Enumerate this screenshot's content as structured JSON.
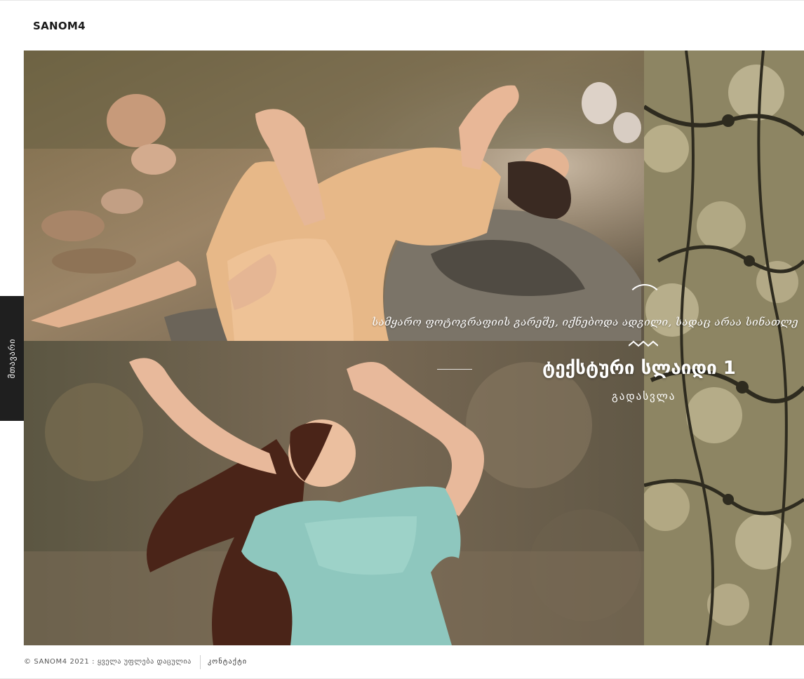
{
  "header": {
    "logo": "SANOM4"
  },
  "side_menu": {
    "label": "მთავარი"
  },
  "slider": {
    "quote": "სამყარო ფოტოგრაფიის გარეშე, იქნებოდა ადგილი, სადაც არაა სინათლე",
    "title": "ტექსტური სლაიდი 1",
    "link": "გადასვლა"
  },
  "footer": {
    "copyright": "© SANOM4 2021 : ყველა უფლება დაცულია",
    "contact": "კონტაქტი"
  }
}
